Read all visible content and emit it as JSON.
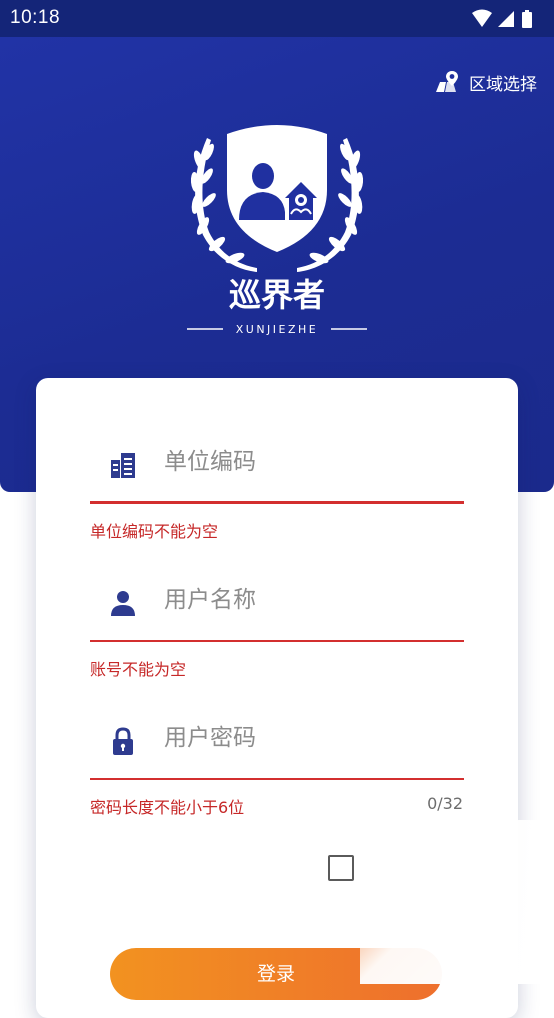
{
  "status_bar": {
    "time": "10:18",
    "icons": [
      "wifi-icon",
      "signal-icon",
      "battery-icon"
    ]
  },
  "header": {
    "region_select_label": "区域选择",
    "region_icon": "map-pin-icon",
    "logo": {
      "title": "巡界者",
      "subtitle": "XUNJIEZHE"
    }
  },
  "form": {
    "unit_code": {
      "placeholder": "单位编码",
      "value": "",
      "icon": "building-icon",
      "error": "单位编码不能为空"
    },
    "username": {
      "placeholder": "用户名称",
      "value": "",
      "icon": "user-icon",
      "error": "账号不能为空"
    },
    "password": {
      "placeholder": "用户密码",
      "value": "",
      "icon": "lock-icon",
      "error": "密码长度不能小于6位",
      "counter": "0/32"
    },
    "remember_checked": false,
    "login_label": "登录"
  },
  "colors": {
    "header_blue": "#1f2f9c",
    "icon_blue": "#2e3b8f",
    "error_red": "#c62828",
    "button_orange_start": "#f29220",
    "button_orange_end": "#ee6f2d"
  }
}
